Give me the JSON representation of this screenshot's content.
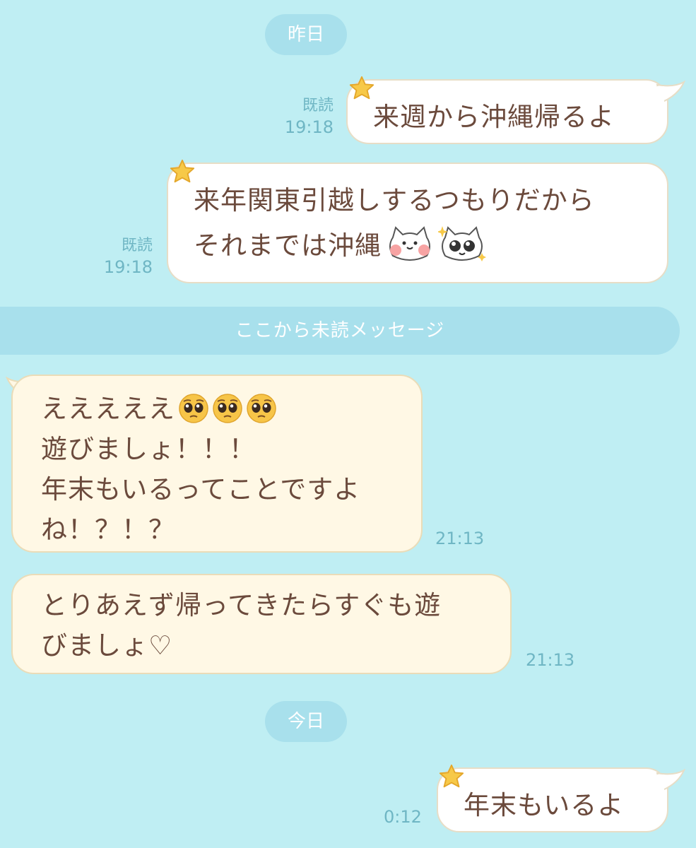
{
  "separators": {
    "yesterday": "昨日",
    "unread": "ここから未読メッセージ",
    "today": "今日"
  },
  "messages": [
    {
      "direction": "out",
      "lines": [
        "来週から沖縄帰るよ"
      ],
      "read": "既読",
      "time": "19:18"
    },
    {
      "direction": "out",
      "lines": [
        "来年関東引越しするつもりだから",
        "それまでは沖縄"
      ],
      "stickers": [
        "cat-blush-icon",
        "cat-sparkle-eyes-icon"
      ],
      "read": "既読",
      "time": "19:18"
    },
    {
      "direction": "in",
      "lines": [
        "えええええ",
        "遊びましょ！！！",
        "年末もいるってことですよ",
        "ね！？！？"
      ],
      "emojis": [
        "pleading-face-icon",
        "pleading-face-icon",
        "pleading-face-icon"
      ],
      "time": "21:13"
    },
    {
      "direction": "in",
      "lines": [
        "とりあえず帰ってきたらすぐも遊",
        "びましょ♡"
      ],
      "time": "21:13"
    },
    {
      "direction": "out",
      "lines": [
        "年末もいるよ"
      ],
      "time": "0:12"
    }
  ],
  "colors": {
    "background": "#bfeef3",
    "pill": "#a8e0ec",
    "outgoing_bubble": "#ffffff",
    "incoming_bubble": "#fff8e5",
    "text": "#6b4a3c",
    "meta": "#6fb6c4",
    "star": "#f7c948"
  }
}
